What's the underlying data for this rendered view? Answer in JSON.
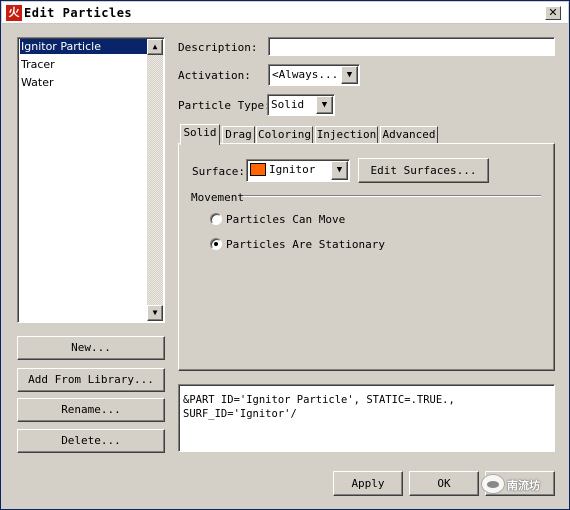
{
  "window": {
    "title": "Edit Particles",
    "close_glyph": "✕",
    "app_icon_glyph": "火"
  },
  "particle_list": {
    "items": [
      {
        "label": "Ignitor Particle",
        "selected": true
      },
      {
        "label": "Tracer",
        "selected": false
      },
      {
        "label": "Water",
        "selected": false
      }
    ]
  },
  "left_buttons": {
    "new": "New...",
    "add_from_library": "Add From Library...",
    "rename": "Rename...",
    "delete": "Delete..."
  },
  "form": {
    "description_label": "Description:",
    "description_value": "",
    "activation_label": "Activation:",
    "activation_value": "<Always...",
    "particle_type_label": "Particle Type:",
    "particle_type_value": "Solid"
  },
  "tabs": [
    {
      "label": "Solid",
      "active": true
    },
    {
      "label": "Drag",
      "active": false
    },
    {
      "label": "Coloring",
      "active": false
    },
    {
      "label": "Injection",
      "active": false
    },
    {
      "label": "Advanced",
      "active": false
    }
  ],
  "solid_tab": {
    "surface_label": "Surface:",
    "surface_value": "Ignitor",
    "surface_color": "#ff6600",
    "edit_surfaces_button": "Edit Surfaces...",
    "movement_group": "Movement",
    "radio_can_move": "Particles Can Move",
    "radio_stationary": "Particles Are Stationary",
    "selected_radio": "radio_stationary"
  },
  "preview": {
    "line1": "&PART ID='Ignitor Particle', STATIC=.TRUE.,",
    "line2": "SURF_ID='Ignitor'/"
  },
  "bottom_buttons": {
    "apply": "Apply",
    "ok": "OK"
  },
  "watermark": {
    "text": "南流坊"
  },
  "icons": {
    "scroll_up": "▲",
    "scroll_down": "▼",
    "dropdown": "▼"
  }
}
